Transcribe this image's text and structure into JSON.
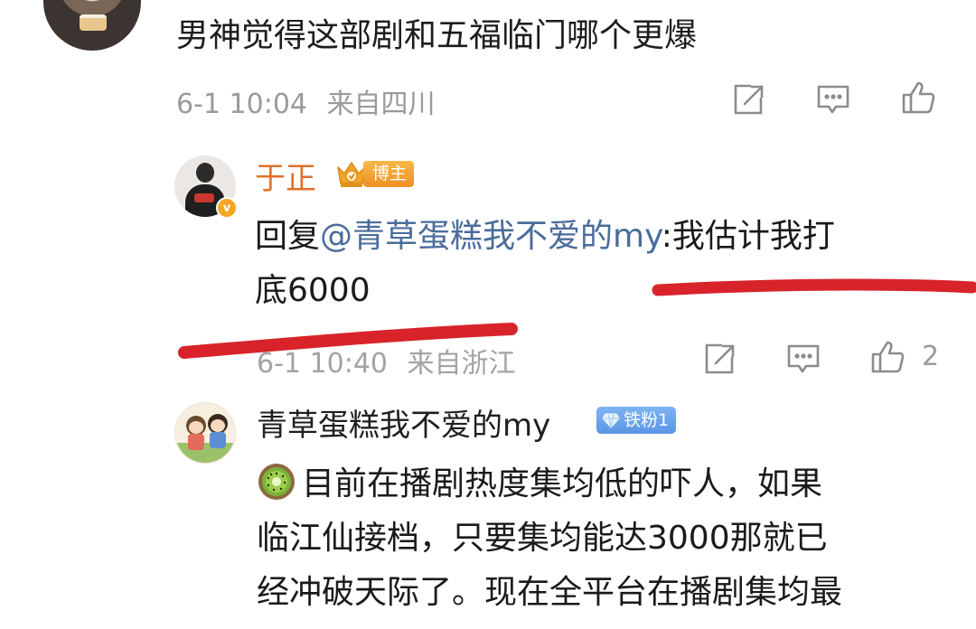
{
  "top_comment": {
    "text": "男神觉得这部剧和五福临门哪个更爆",
    "time": "6-1 10:04",
    "location": "来自四川"
  },
  "reply": {
    "author": "于正",
    "author_badge": "博主",
    "verified_mark": "v",
    "prefix": "回复",
    "mention": "@青草蛋糕我不爱的my",
    "line1_rest": ":我估计我打",
    "line2": "底6000",
    "time": "6-1 10:40",
    "location": "来自浙江",
    "like_count": "2"
  },
  "comment": {
    "author": "青草蛋糕我不爱的my",
    "fan_badge": "铁粉1",
    "emoji": "kiwi-emoji",
    "lines": [
      "目前在播剧热度集均低的吓人，如果",
      "临江仙接档，只要集均能达3000那就已",
      "经冲破天际了。现在全平台在播剧集均最"
    ]
  },
  "icons": {
    "share": "share-icon",
    "comment": "comment-icon",
    "like": "like-icon",
    "crown": "crown-icon",
    "gem": "diamond-icon"
  },
  "colors": {
    "author_highlight": "#e0712a",
    "mention": "#4a6c9b",
    "meta": "#9a9a9a",
    "annotation_red": "#d8232a",
    "badge_orange": "#ef8f21",
    "badge_blue": "#5b95e6"
  }
}
